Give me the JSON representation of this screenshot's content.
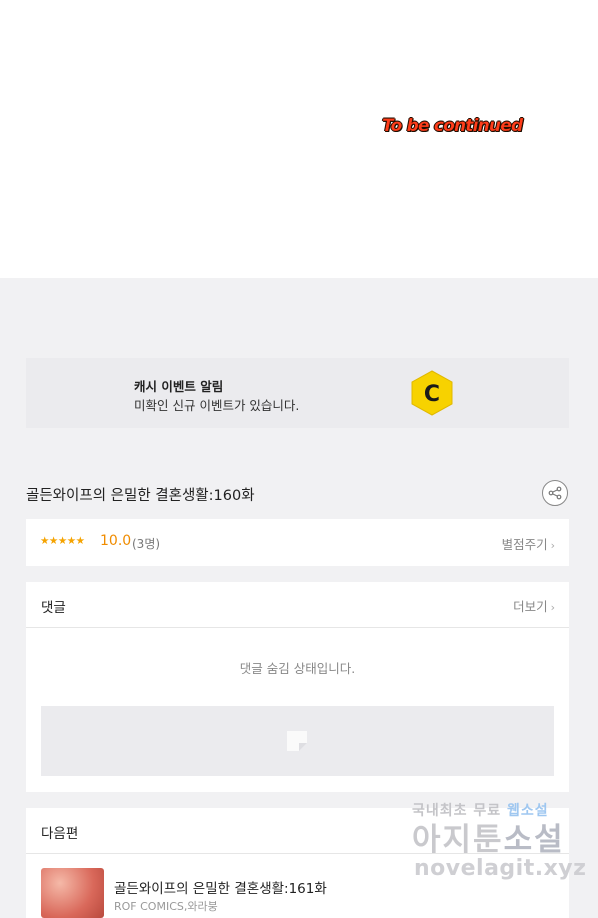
{
  "comic_end": {
    "text": "To be continued"
  },
  "cash_banner": {
    "title": "캐시 이벤트 알림",
    "description": "미확인 신규 이벤트가 있습니다.",
    "coin_letter": "C"
  },
  "episode": {
    "title": "골든와이프의 은밀한 결혼생활:160화",
    "share_icon": "share-icon"
  },
  "rating": {
    "stars": "★★★★★",
    "score": "10.0",
    "count": "(3명)",
    "rate_label": "별점주기",
    "accent_color": "#f08c00"
  },
  "comments": {
    "header": "댓글",
    "more_label": "더보기",
    "hidden_message": "댓글 숨김 상태입니다."
  },
  "next_episode": {
    "header": "다음편",
    "title": "골든와이프의 은밀한 결혼생활:161화",
    "subtitle": "ROF COMICS,와라붕"
  },
  "watermark": {
    "line1_a": "국내최초 무료 ",
    "line1_b": "웹소설",
    "line2_a": "아지툰",
    "line2_b": "소설",
    "line3": "novelagit.xyz"
  },
  "chevron": "›"
}
